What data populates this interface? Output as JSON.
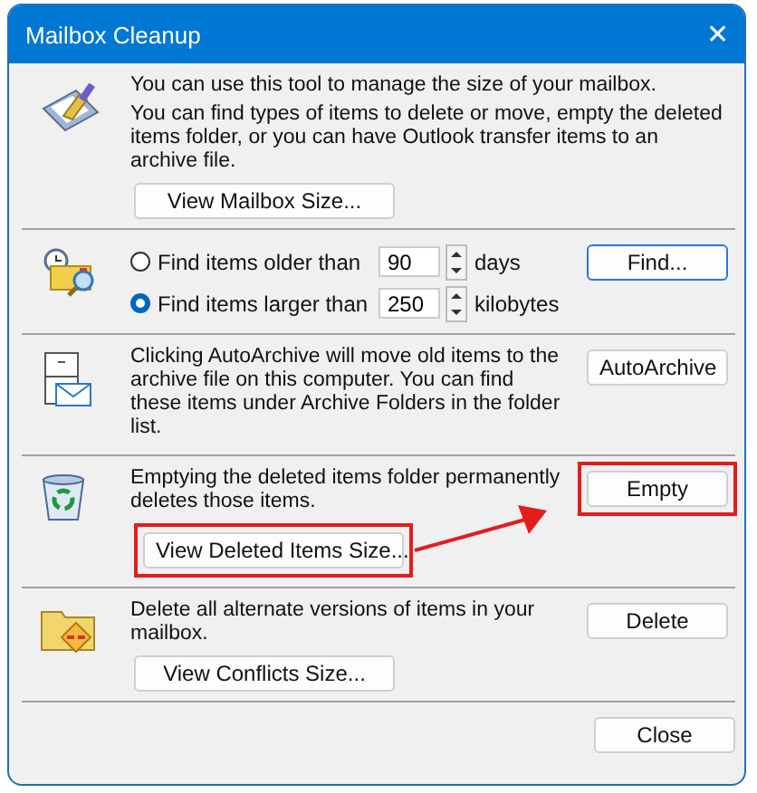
{
  "window": {
    "title": "Mailbox Cleanup",
    "close": "✕"
  },
  "sections": [
    {
      "kind": "intro",
      "paragraphs": [
        "You can use this tool to manage the size of your mailbox.",
        "You can find types of items to delete or move, empty the deleted items folder, or you can have Outlook transfer items to an archive file."
      ],
      "button": {
        "label": "View Mailbox Size..."
      }
    },
    {
      "kind": "find",
      "options": [
        {
          "label": "Find items older than",
          "selected": false,
          "value": "90",
          "unit": "days"
        },
        {
          "label": "Find items larger than",
          "selected": true,
          "value": "250",
          "unit": "kilobytes"
        }
      ],
      "side_button": {
        "label": "Find...",
        "focused": true
      }
    },
    {
      "kind": "text",
      "paragraphs": [
        "Clicking AutoArchive will move old items to the archive file on this computer. You can find these items under Archive Folders in the folder list."
      ],
      "side_button": {
        "label": "AutoArchive",
        "focused": false
      }
    },
    {
      "kind": "intro",
      "paragraphs": [
        "Emptying the deleted items folder permanently deletes those items."
      ],
      "button": {
        "label": "View Deleted Items Size...",
        "highlighted": true
      },
      "side_button": {
        "label": "Empty",
        "highlighted": true,
        "focused": false
      },
      "arrow": true
    },
    {
      "kind": "intro",
      "paragraphs": [
        "Delete all alternate versions of items in your mailbox."
      ],
      "button": {
        "label": "View Conflicts Size..."
      },
      "side_button": {
        "label": "Delete",
        "focused": false
      }
    }
  ],
  "footer": {
    "button": "Close"
  }
}
